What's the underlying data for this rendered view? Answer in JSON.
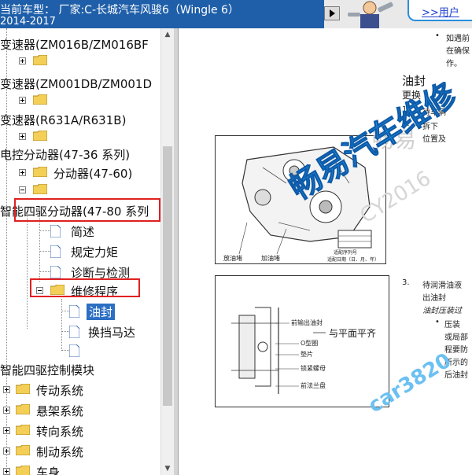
{
  "header": {
    "title_line1": "当前车型： 厂家:C-长城汽车风骏6（Wingle 6）",
    "title_line2": "2014-2017",
    "nav_button_icon": "next-arrow-icon",
    "user_link": ">>用户"
  },
  "tree": {
    "items": [
      {
        "label": "变速器(ZM016B/ZM016BF"
      },
      {
        "label": ""
      },
      {
        "label": "变速器(ZM001DB/ZM001D"
      },
      {
        "label": ""
      },
      {
        "label": "变速器(R631A/R631B)"
      },
      {
        "label": ""
      },
      {
        "label": "电控分动器(47-36 系列)"
      },
      {
        "label": "分动器(47-60)"
      },
      {
        "label": ""
      },
      {
        "label": "智能四驱分动器(47-80 系列"
      },
      {
        "label": "简述"
      },
      {
        "label": "规定力矩"
      },
      {
        "label": "诊断与检测"
      },
      {
        "label": "维修程序"
      },
      {
        "label": "油封"
      },
      {
        "label": "换挡马达"
      },
      {
        "label": ""
      },
      {
        "label": "智能四驱控制模块"
      },
      {
        "label": "传动系统"
      },
      {
        "label": "悬架系统"
      },
      {
        "label": "转向系统"
      },
      {
        "label": "制动系统"
      },
      {
        "label": "车身"
      }
    ]
  },
  "doc": {
    "bullet_top": "如遇前",
    "line_a": "在确保",
    "line_b": "作。",
    "section_title": "油封",
    "section_sub": "更换",
    "step1_num": "1.",
    "step1_text": "待车辆",
    "step2_num": "2.",
    "step2_text": "拆下",
    "step2_text2": "位置及",
    "fig1_labels": {
      "left": "放油堵",
      "mid": "加油堵",
      "right1": "适配序列号",
      "right2": "适配日期（日、月、年）"
    },
    "step3_num": "3.",
    "step3_text": "待润滑油液",
    "step3_text2": "出油封",
    "step3_italic": "油封压装过",
    "bullet2": "压装",
    "b2_1": "或局部",
    "b2_2": "程要防",
    "b2_3": "所示的",
    "b2_4": "后油封",
    "fig2_labels": {
      "l1": "前输出油封",
      "flush": "与平面平齐",
      "l2": "O型圈",
      "l3": "垫片",
      "l4": "锁紧螺母",
      "l5": "前法兰盘"
    },
    "watermark_big": "畅易汽车维修",
    "watermark_url": "car3820",
    "watermark_faint1": "畅易",
    "watermark_faint2": "CY2016"
  },
  "colors": {
    "title_bg": "#1f5fa9",
    "highlight_box": "#e02020",
    "selected_bg": "#2c6fc3",
    "watermark": "#1f8fe0"
  }
}
